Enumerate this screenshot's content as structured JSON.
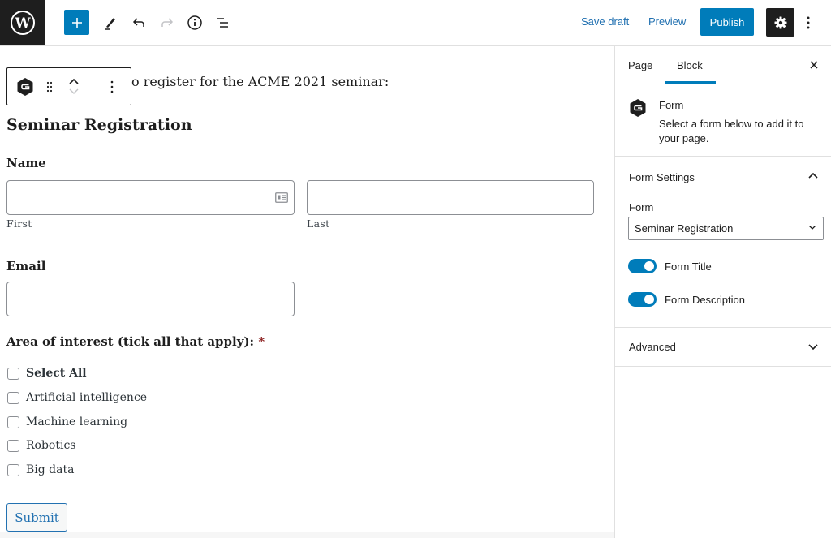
{
  "topbar": {
    "logo": "wordpress-logo",
    "tools": [
      "add-block-icon",
      "edit-pencil-icon",
      "undo-icon",
      "redo-icon",
      "info-icon",
      "list-view-icon"
    ],
    "save_draft": "Save draft",
    "preview": "Preview",
    "publish": "Publish"
  },
  "editor": {
    "intro_text": "o register for the ACME 2021 seminar:",
    "form_title": "Seminar Registration",
    "name_label": "Name",
    "first_sublabel": "First",
    "last_sublabel": "Last",
    "first_value": "",
    "last_value": "",
    "email_label": "Email",
    "email_value": "",
    "interest_label": "Area of interest (tick all that apply):",
    "required_mark": "*",
    "checkboxes": [
      {
        "label": "Select All",
        "checked": false,
        "bold": true
      },
      {
        "label": "Artificial intelligence",
        "checked": false
      },
      {
        "label": "Machine learning",
        "checked": false
      },
      {
        "label": "Robotics",
        "checked": false
      },
      {
        "label": "Big data",
        "checked": false
      }
    ],
    "submit": "Submit"
  },
  "sidebar": {
    "tabs": [
      {
        "label": "Page",
        "active": false
      },
      {
        "label": "Block",
        "active": true
      }
    ],
    "block": {
      "name": "Form",
      "description": "Select a form below to add it to your page."
    },
    "form_settings": {
      "title": "Form Settings",
      "expanded": true,
      "form_label": "Form",
      "form_selected": "Seminar Registration",
      "toggles": [
        {
          "label": "Form Title",
          "on": true
        },
        {
          "label": "Form Description",
          "on": true
        }
      ]
    },
    "advanced": {
      "title": "Advanced",
      "expanded": false
    }
  },
  "colors": {
    "accent": "#007cba",
    "dark": "#1e1e1e",
    "link": "#2271b1",
    "required": "#8a1c1c"
  }
}
